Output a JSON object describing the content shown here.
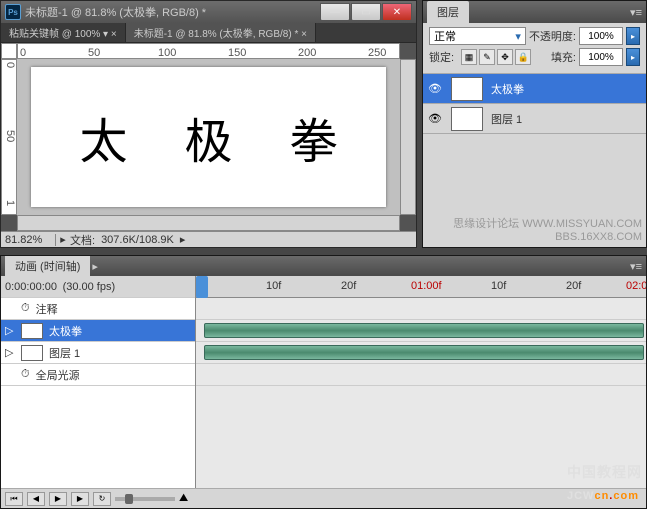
{
  "doc": {
    "title": "未标题-1 @ 81.8% (太极拳, RGB/8) *",
    "tab1": "粘贴关键帧 @ 100% ▾ ×",
    "tab2": "未标题-1 @ 81.8% (太极拳, RGB/8) * ×",
    "canvas_chars": [
      "太",
      "极",
      "拳"
    ],
    "zoom": "81.82%",
    "status_label": "文档:",
    "status_size": "307.6K/108.9K",
    "ruler_h": [
      "0",
      "50",
      "100",
      "150",
      "200",
      "250"
    ],
    "ruler_v": [
      "0",
      "50",
      "1"
    ]
  },
  "layers": {
    "panel_title": "图层",
    "blend": "正常",
    "opacity_label": "不透明度:",
    "opacity": "100%",
    "lock_label": "锁定:",
    "fill_label": "填充:",
    "fill": "100%",
    "rows": [
      {
        "name": "太极拳",
        "type": "T",
        "selected": true
      },
      {
        "name": "图层 1",
        "type": "",
        "selected": false
      }
    ]
  },
  "timeline": {
    "panel_title": "动画 (时间轴)",
    "time": "0:00:00:00",
    "fps": "(30.00 fps)",
    "ruler": [
      "10f",
      "20f",
      "01:00f",
      "10f",
      "20f",
      "02:0"
    ],
    "tracks": [
      {
        "name": "注释",
        "icon": "clock"
      },
      {
        "name": "太极拳",
        "icon": "T",
        "selected": true,
        "clip": true
      },
      {
        "name": "图层 1",
        "icon": "box",
        "clip": true
      },
      {
        "name": "全局光源",
        "icon": "clock"
      }
    ]
  },
  "watermarks": {
    "mid1": "思缘设计论坛   WWW.MISSYUAN.COM",
    "mid2": "BBS.16XX8.COM",
    "big_cn": "中国教程网",
    "big_en1": "JCW",
    "big_en2": "cn",
    "big_en3": "com"
  }
}
